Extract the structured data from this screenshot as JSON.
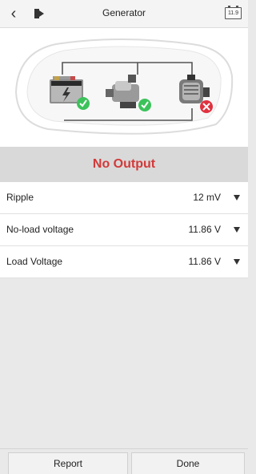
{
  "header": {
    "title": "Generator",
    "battery_text": "11.9"
  },
  "diagram": {
    "components": [
      {
        "name": "battery",
        "status": "ok"
      },
      {
        "name": "starter",
        "status": "ok"
      },
      {
        "name": "generator",
        "status": "fault"
      }
    ],
    "colors": {
      "ok": "#3cc25a",
      "fault": "#e0313f"
    }
  },
  "result": {
    "status_text": "No Output",
    "status_color": "#d23a3a"
  },
  "measurements": [
    {
      "label": "Ripple",
      "value": "12 mV"
    },
    {
      "label": "No-load voltage",
      "value": "11.86 V"
    },
    {
      "label": "Load Voltage",
      "value": "11.86 V"
    }
  ],
  "footer": {
    "report_label": "Report",
    "done_label": "Done"
  }
}
